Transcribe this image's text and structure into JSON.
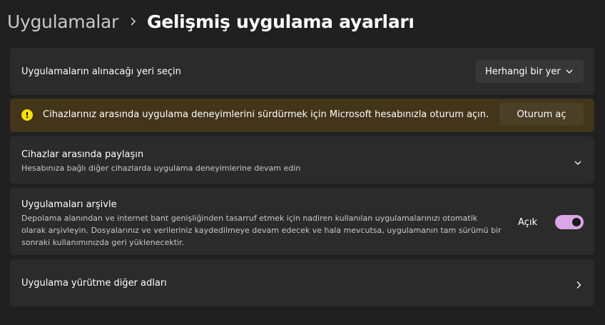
{
  "breadcrumb": {
    "parent": "Uygulamalar",
    "separator_icon": "chevron-right-icon",
    "current": "Gelişmiş uygulama ayarları"
  },
  "install_source": {
    "label": "Uygulamaların alınacağı yeri seçin",
    "selected": "Herhangi bir yer",
    "icon": "chevron-down-icon"
  },
  "signin_banner": {
    "icon": "warning-icon",
    "text": "Cihazlarınız arasında uygulama deneyimlerini sürdürmek için Microsoft hesabınızla oturum açın.",
    "button_label": "Oturum aç",
    "background": "#433519",
    "icon_color": "#fce100"
  },
  "share_across_devices": {
    "title": "Cihazlar arasında paylaşın",
    "description": "Hesabınıza bağlı diğer cihazlarda uygulama deneyimlerine devam edin",
    "icon": "chevron-down-icon"
  },
  "archive_apps": {
    "title": "Uygulamaları arşivle",
    "description": "Depolama alanından ve internet bant genişliğinden tasarruf etmek için nadiren kullanılan uygulamalarınızı otomatik olarak arşivleyin. Dosyalarınız ve verileriniz kaydedilmeye devam edecek ve hala mevcutsa, uygulamanın tam sürümü bir sonraki kullanımınızda geri yüklenecektir.",
    "toggle_label": "Açık",
    "toggle_on": true,
    "accent": "#d9a6e8"
  },
  "execution_aliases": {
    "title": "Uygulama yürütme diğer adları",
    "icon": "chevron-right-icon"
  }
}
